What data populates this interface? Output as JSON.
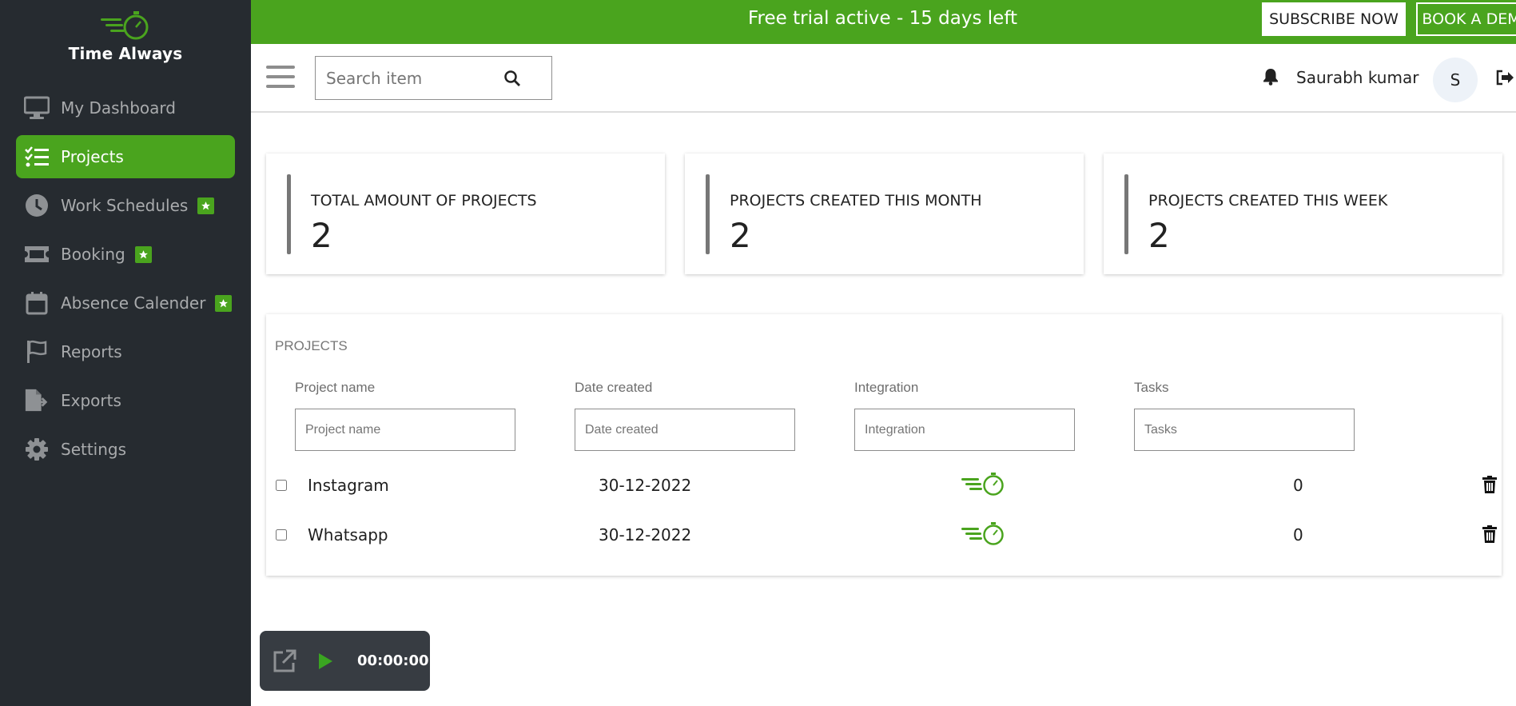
{
  "brand": {
    "name": "Time Always",
    "color": "#4aa41e"
  },
  "sidebar": {
    "items": [
      {
        "label": "My Dashboard",
        "icon": "monitor-icon",
        "active": false,
        "badge": false
      },
      {
        "label": "Projects",
        "icon": "checklist-icon",
        "active": true,
        "badge": false
      },
      {
        "label": "Work Schedules",
        "icon": "clock-icon",
        "active": false,
        "badge": true
      },
      {
        "label": "Booking",
        "icon": "ticket-icon",
        "active": false,
        "badge": true
      },
      {
        "label": "Absence Calender",
        "icon": "calendar-icon",
        "active": false,
        "badge": true
      },
      {
        "label": "Reports",
        "icon": "flag-icon",
        "active": false,
        "badge": false
      },
      {
        "label": "Exports",
        "icon": "file-export-icon",
        "active": false,
        "badge": false
      },
      {
        "label": "Settings",
        "icon": "gear-icon",
        "active": false,
        "badge": false
      }
    ]
  },
  "banner": {
    "text": "Free trial active - 15 days left",
    "subscribe_label": "SUBSCRIBE NOW",
    "demo_label": "BOOK A DEMO",
    "background": "#4aa41e"
  },
  "header": {
    "search_placeholder": "Search item",
    "user_name": "Saurabh kumar",
    "avatar_initial": "S"
  },
  "stats": [
    {
      "label": "TOTAL AMOUNT OF PROJECTS",
      "value": "2"
    },
    {
      "label": "PROJECTS CREATED THIS MONTH",
      "value": "2"
    },
    {
      "label": "PROJECTS CREATED THIS WEEK",
      "value": "2"
    }
  ],
  "projects": {
    "title": "PROJECTS",
    "columns": [
      {
        "label": "Project name",
        "placeholder": "Project name"
      },
      {
        "label": "Date created",
        "placeholder": "Date created"
      },
      {
        "label": "Integration",
        "placeholder": "Integration"
      },
      {
        "label": "Tasks",
        "placeholder": "Tasks"
      }
    ],
    "rows": [
      {
        "name": "Instagram",
        "date": "30-12-2022",
        "integration_icon": "time-always-stopwatch-icon",
        "tasks": "0"
      },
      {
        "name": "Whatsapp",
        "date": "30-12-2022",
        "integration_icon": "time-always-stopwatch-icon",
        "tasks": "0"
      }
    ]
  },
  "timer": {
    "time": "00:00:00",
    "play_color": "#3aa521"
  }
}
